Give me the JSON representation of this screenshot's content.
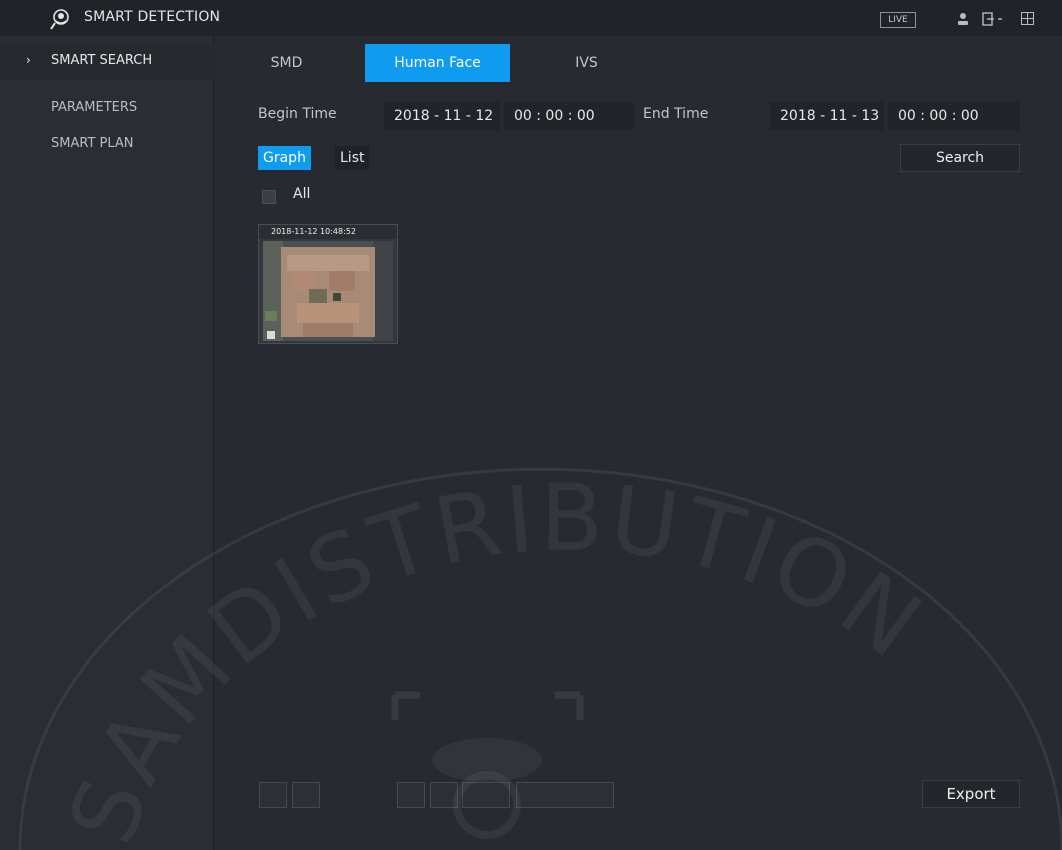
{
  "app": {
    "title": "SMART DETECTION",
    "live_label": "LIVE"
  },
  "sidebar": {
    "items": [
      {
        "label": "SMART SEARCH",
        "active": true
      },
      {
        "label": "PARAMETERS"
      },
      {
        "label": "SMART PLAN"
      }
    ]
  },
  "tabs": [
    {
      "label": "SMD"
    },
    {
      "label": "Human Face",
      "active": true
    },
    {
      "label": "IVS"
    }
  ],
  "filters": {
    "begin_label": "Begin Time",
    "begin_date": "2018 - 11 - 12",
    "begin_time": "00 : 00 : 00",
    "end_label": "End Time",
    "end_date": "2018 - 11 - 13",
    "end_time": "00 : 00 : 00"
  },
  "view": {
    "graph_label": "Graph",
    "list_label": "List",
    "all_label": "All",
    "search_label": "Search"
  },
  "results": [
    {
      "timestamp": "2018-11-12 10:48:52"
    }
  ],
  "footer": {
    "export_label": "Export"
  },
  "watermark": {
    "text": "SAMDISTRIBUTION"
  },
  "colors": {
    "accent": "#0e9bf0",
    "background": "#272a30",
    "sidebar": "#2a2d32"
  },
  "icons": [
    "smart-detection-logo-icon",
    "user-icon",
    "exit-icon",
    "grid-icon",
    "chevron-right-icon"
  ]
}
